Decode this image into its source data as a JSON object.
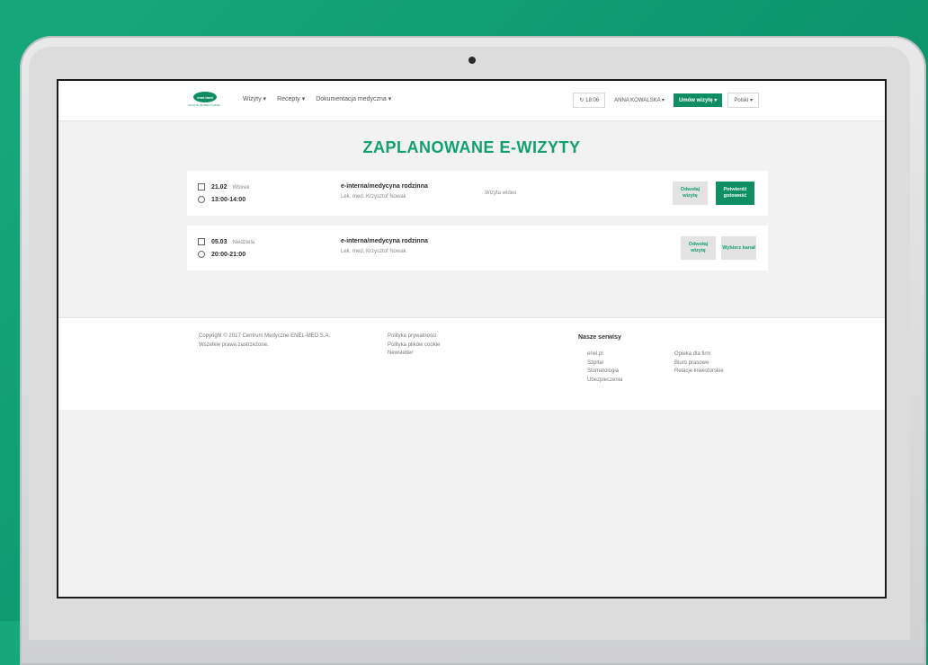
{
  "header": {
    "logo_text": "enel-med",
    "logo_sub": "CENTRUM MEDYCZNE",
    "nav": [
      "Wizyty ▾",
      "Recepty ▾",
      "Dokumentacja medyczna ▾"
    ],
    "time": "↻ 18:06",
    "user": "ANNA KOWALSKA ▾",
    "book_button": "Umów wizytę ▾",
    "language": "Polski ▾"
  },
  "page_title": "ZAPLANOWANE E-WIZYTY",
  "visits": [
    {
      "date": "21.02",
      "day": "Wtorek",
      "time": "13:00-14:00",
      "specialty": "e-interna/medycyna rodzinna",
      "doctor": "Lek. med. Krzysztof Nowak",
      "type": "Wizyta wideo",
      "button_secondary": "Odwołaj wizytę",
      "button_primary": "Potwierdź gotowość"
    },
    {
      "date": "05.03",
      "day": "Niedziela",
      "time": "20:00-21:00",
      "specialty": "e-interna/medycyna rodzinna",
      "doctor": "Lek. med. Krzysztof Nowak",
      "type": "",
      "button_secondary": "Odwołaj wizytę",
      "button_secondary2": "Wybierz kanał"
    }
  ],
  "footer": {
    "copyright_line1": "Copyright © 2017 Centrum Medyczne ENEL-MED S.A.",
    "copyright_line2": "Wszelkie prawa zastrzeżone.",
    "links": [
      "Polityka prywatności",
      "Polityka plików cookie",
      "Newsletter"
    ],
    "services_title": "Nasze serwisy",
    "services_col1": [
      "enel.pl",
      "Szpital",
      "Stomatologia",
      "Ubezpieczenia"
    ],
    "services_col2": [
      "Opieka dla firm",
      "Biuro prasowe",
      "Relacje inwestorskie"
    ]
  },
  "colors": {
    "brand_green": "#0f8e63",
    "title_green": "#13a06f",
    "background": "#16a87a"
  }
}
